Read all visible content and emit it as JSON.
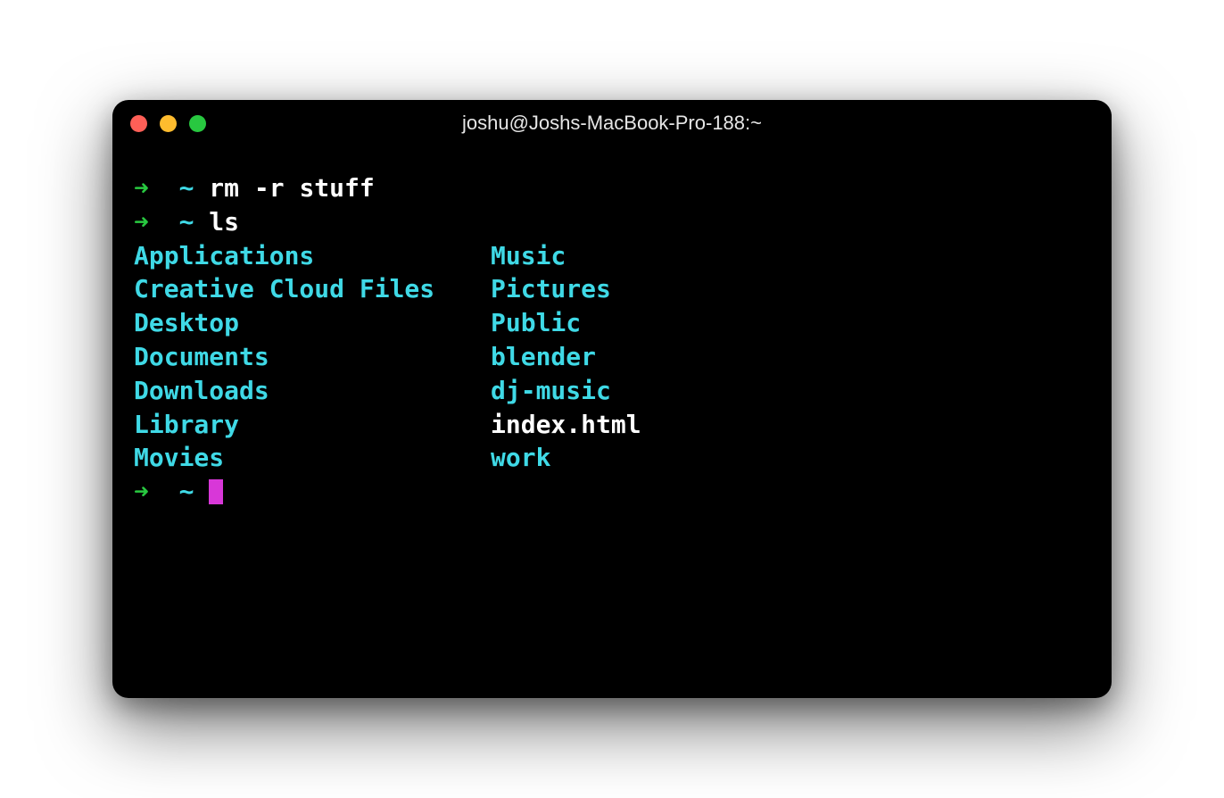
{
  "window": {
    "title": "joshu@Joshs-MacBook-Pro-188:~"
  },
  "prompt": {
    "arrow": "➜",
    "path": "~"
  },
  "history": [
    {
      "command": "rm -r stuff"
    },
    {
      "command": "ls"
    }
  ],
  "ls_output": {
    "col1": [
      {
        "name": "Applications",
        "type": "dir"
      },
      {
        "name": "Creative Cloud Files",
        "type": "dir"
      },
      {
        "name": "Desktop",
        "type": "dir"
      },
      {
        "name": "Documents",
        "type": "dir"
      },
      {
        "name": "Downloads",
        "type": "dir"
      },
      {
        "name": "Library",
        "type": "dir"
      },
      {
        "name": "Movies",
        "type": "dir"
      }
    ],
    "col2": [
      {
        "name": "Music",
        "type": "dir"
      },
      {
        "name": "Pictures",
        "type": "dir"
      },
      {
        "name": "Public",
        "type": "dir"
      },
      {
        "name": "blender",
        "type": "dir"
      },
      {
        "name": "dj-music",
        "type": "dir"
      },
      {
        "name": "index.html",
        "type": "file"
      },
      {
        "name": "work",
        "type": "dir"
      }
    ]
  },
  "colors": {
    "prompt_arrow": "#28c840",
    "prompt_path": "#3fd9e6",
    "directory": "#3fd9e6",
    "file": "#ffffff",
    "cursor": "#d837d8"
  }
}
